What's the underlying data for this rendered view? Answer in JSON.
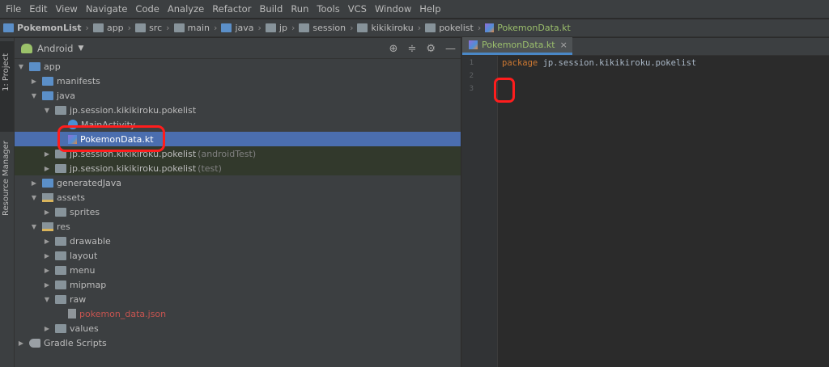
{
  "menu": [
    "File",
    "Edit",
    "View",
    "Navigate",
    "Code",
    "Analyze",
    "Refactor",
    "Build",
    "Run",
    "Tools",
    "VCS",
    "Window",
    "Help"
  ],
  "breadcrumbs": [
    "PokemonList",
    "app",
    "src",
    "main",
    "java",
    "jp",
    "session",
    "kikikiroku",
    "pokelist",
    "PokemonData.kt"
  ],
  "side_strip": {
    "project_tab": "1: Project",
    "resource_tab": "Resource Manager"
  },
  "panel": {
    "view_mode": "Android",
    "tools": [
      "target-icon",
      "collapse-icon",
      "gear-icon",
      "minimize-icon"
    ]
  },
  "tree": [
    {
      "label": "app",
      "arrow": "▼",
      "icon": "folder-module-icon"
    },
    {
      "label": "manifests",
      "arrow": "▶",
      "icon": "folder-icon"
    },
    {
      "label": "java",
      "arrow": "▼",
      "icon": "folder-icon"
    },
    {
      "label": "jp.session.kikikiroku.pokelist",
      "arrow": "▼",
      "icon": "package-icon"
    },
    {
      "label": "MainActivity",
      "arrow": "",
      "icon": "class-icon"
    },
    {
      "label": "PokemonData.kt",
      "arrow": "",
      "icon": "kotlin-file-icon"
    },
    {
      "label": "jp.session.kikikiroku.pokelist",
      "suffix": "(androidTest)",
      "arrow": "▶",
      "icon": "package-icon"
    },
    {
      "label": "jp.session.kikikiroku.pokelist",
      "suffix": "(test)",
      "arrow": "▶",
      "icon": "package-icon"
    },
    {
      "label": "generatedJava",
      "arrow": "▶",
      "icon": "folder-icon"
    },
    {
      "label": "assets",
      "arrow": "▼",
      "icon": "resource-folder-icon"
    },
    {
      "label": "sprites",
      "arrow": "▶",
      "icon": "folder-icon"
    },
    {
      "label": "res",
      "arrow": "▼",
      "icon": "resource-folder-icon"
    },
    {
      "label": "drawable",
      "arrow": "▶",
      "icon": "folder-icon"
    },
    {
      "label": "layout",
      "arrow": "▶",
      "icon": "folder-icon"
    },
    {
      "label": "menu",
      "arrow": "▶",
      "icon": "folder-icon"
    },
    {
      "label": "mipmap",
      "arrow": "▶",
      "icon": "folder-icon"
    },
    {
      "label": "raw",
      "arrow": "▼",
      "icon": "folder-icon"
    },
    {
      "label": "pokemon_data.json",
      "arrow": "",
      "icon": "json-file-icon"
    },
    {
      "label": "values",
      "arrow": "▶",
      "icon": "folder-icon"
    },
    {
      "label": "Gradle Scripts",
      "arrow": "▶",
      "icon": "gradle-icon"
    }
  ],
  "editor": {
    "tab_label": "PokemonData.kt",
    "close": "×",
    "line_numbers": [
      "1",
      "2",
      "3"
    ],
    "code": {
      "keyword": "package",
      "package_name": "jp.session.kikikiroku.pokelist"
    }
  },
  "colors": {
    "selection": "#4b6eaf",
    "annotation": "#ff1d1d",
    "keyword": "#cc7832",
    "error_file": "#c75450"
  }
}
